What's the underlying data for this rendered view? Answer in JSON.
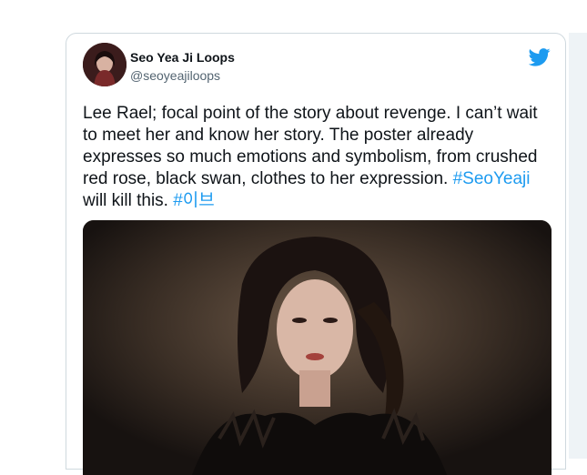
{
  "tweet": {
    "display_name": "Seo Yea Ji Loops",
    "handle": "@seoyeajiloops",
    "text_main": "Lee Rael; focal point of the story about revenge. I can’t wait to meet her and know her story. The poster already expresses so much emotions and symbolism, from crushed red rose, black swan, clothes to her expression. ",
    "hashtag_1": "#SeoYeaji",
    "text_mid": " will kill this. ",
    "hashtag_2": "#이브"
  },
  "colors": {
    "link": "#1d9bf0",
    "text": "#0f1419",
    "secondary": "#536471",
    "twitter_blue": "#1d9bf0"
  },
  "icons": {
    "brand": "twitter-bird-icon"
  }
}
